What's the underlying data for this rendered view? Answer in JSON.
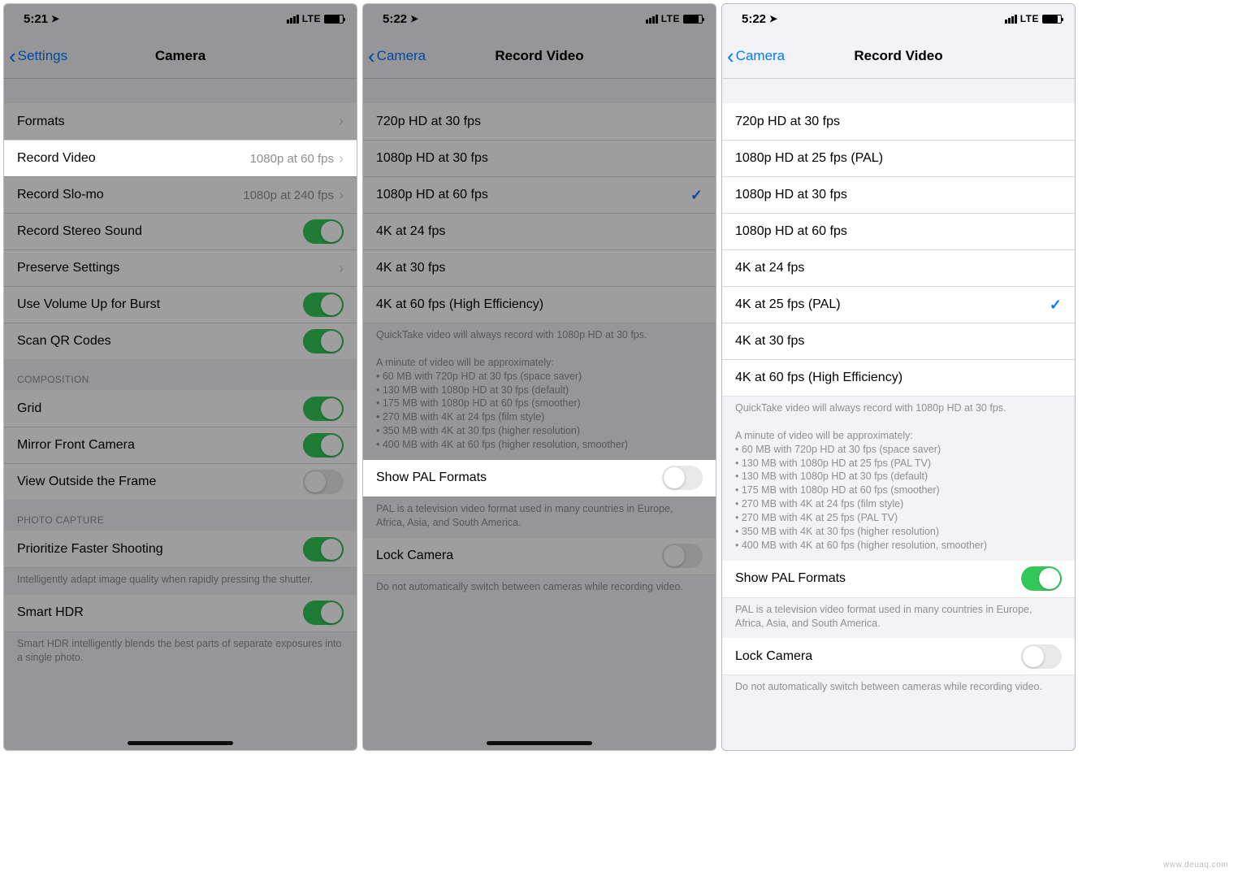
{
  "watermark": "www.deuaq.com",
  "phone1": {
    "status": {
      "time": "5:21",
      "network": "LTE"
    },
    "nav": {
      "back": "Settings",
      "title": "Camera"
    },
    "rows": {
      "formats": "Formats",
      "record_video": {
        "label": "Record Video",
        "detail": "1080p at 60 fps"
      },
      "record_slomo": {
        "label": "Record Slo-mo",
        "detail": "1080p at 240 fps"
      },
      "stereo": "Record Stereo Sound",
      "preserve": "Preserve Settings",
      "volume_burst": "Use Volume Up for Burst",
      "scan_qr": "Scan QR Codes"
    },
    "headers": {
      "composition": "COMPOSITION",
      "photo_capture": "PHOTO CAPTURE"
    },
    "composition": {
      "grid": "Grid",
      "mirror": "Mirror Front Camera",
      "viewoutside": "View Outside the Frame"
    },
    "photo_capture": {
      "prioritize": "Prioritize Faster Shooting",
      "prioritize_footer": "Intelligently adapt image quality when rapidly pressing the shutter.",
      "smart_hdr": "Smart HDR",
      "smart_hdr_footer": "Smart HDR intelligently blends the best parts of separate exposures into a single photo."
    }
  },
  "phone2": {
    "status": {
      "time": "5:22",
      "network": "LTE"
    },
    "nav": {
      "back": "Camera",
      "title": "Record Video"
    },
    "options": [
      "720p HD at 30 fps",
      "1080p HD at 30 fps",
      "1080p HD at 60 fps",
      "4K at 24 fps",
      "4K at 30 fps",
      "4K at 60 fps (High Efficiency)"
    ],
    "selected_index": 2,
    "footer_lead": "QuickTake video will always record with 1080p HD at 30 fps.",
    "footer_intro": "A minute of video will be approximately:",
    "footer_bullets": [
      "• 60 MB with 720p HD at 30 fps (space saver)",
      "• 130 MB with 1080p HD at 30 fps (default)",
      "• 175 MB with 1080p HD at 60 fps (smoother)",
      "• 270 MB with 4K at 24 fps (film style)",
      "• 350 MB with 4K at 30 fps (higher resolution)",
      "• 400 MB with 4K at 60 fps (higher resolution, smoother)"
    ],
    "pal_toggle": "Show PAL Formats",
    "pal_footer": "PAL is a television video format used in many countries in Europe, Africa, Asia, and South America.",
    "lock_camera": "Lock Camera",
    "lock_footer": "Do not automatically switch between cameras while recording video."
  },
  "phone3": {
    "status": {
      "time": "5:22",
      "network": "LTE"
    },
    "nav": {
      "back": "Camera",
      "title": "Record Video"
    },
    "options": [
      "720p HD at 30 fps",
      "1080p HD at 25 fps (PAL)",
      "1080p HD at 30 fps",
      "1080p HD at 60 fps",
      "4K at 24 fps",
      "4K at 25 fps (PAL)",
      "4K at 30 fps",
      "4K at 60 fps (High Efficiency)"
    ],
    "selected_index": 5,
    "footer_lead": "QuickTake video will always record with 1080p HD at 30 fps.",
    "footer_intro": "A minute of video will be approximately:",
    "footer_bullets": [
      "• 60 MB with 720p HD at 30 fps (space saver)",
      "• 130 MB with 1080p HD at 25 fps (PAL TV)",
      "• 130 MB with 1080p HD at 30 fps (default)",
      "• 175 MB with 1080p HD at 60 fps (smoother)",
      "• 270 MB with 4K at 24 fps (film style)",
      "• 270 MB with 4K at 25 fps (PAL TV)",
      "• 350 MB with 4K at 30 fps (higher resolution)",
      "• 400 MB with 4K at 60 fps (higher resolution, smoother)"
    ],
    "pal_toggle": "Show PAL Formats",
    "pal_footer": "PAL is a television video format used in many countries in Europe, Africa, Asia, and South America.",
    "lock_camera": "Lock Camera",
    "lock_footer": "Do not automatically switch between cameras while recording video."
  }
}
